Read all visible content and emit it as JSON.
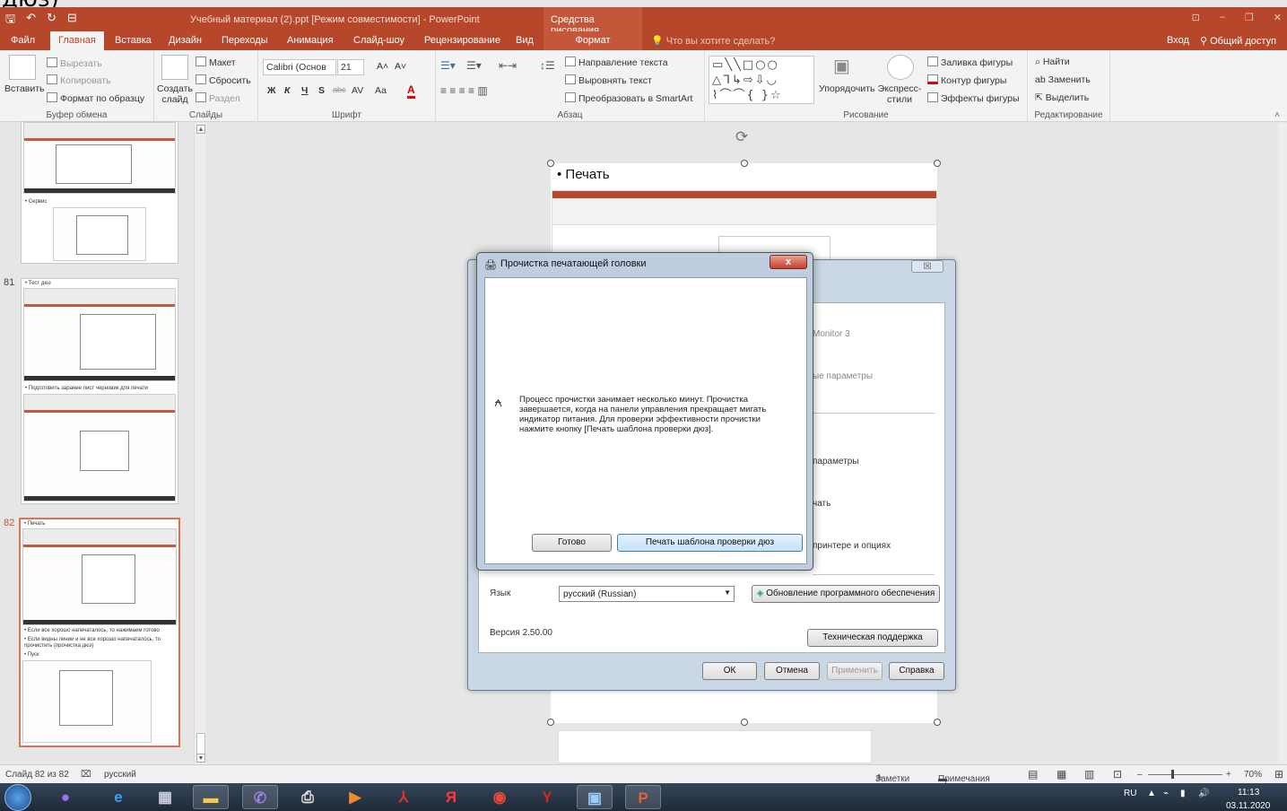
{
  "top_fragment": "дюз)",
  "titlebar": {
    "qat": [
      "🖫",
      "↶",
      "↻",
      "⊟"
    ],
    "doc_title": "Учебный материал (2).ppt [Режим совместимости] - PowerPoint",
    "context_group": "Средства рисования",
    "window_controls": [
      "⊡",
      "–",
      "❐",
      "✕"
    ]
  },
  "tabs": {
    "file": "Файл",
    "home": "Главная",
    "insert": "Вставка",
    "design": "Дизайн",
    "transitions": "Переходы",
    "animation": "Анимация",
    "slideshow": "Слайд-шоу",
    "review": "Рецензирование",
    "view": "Вид",
    "format": "Формат",
    "tell_me": "Что вы хотите сделать?",
    "signin": "Вход",
    "share": "Общий доступ"
  },
  "ribbon": {
    "clipboard": {
      "label": "Буфер обмена",
      "paste": "Вставить",
      "cut": "Вырезать",
      "copy": "Копировать",
      "format_painter": "Формат по образцу"
    },
    "slides": {
      "label": "Слайды",
      "new_slide": "Создать слайд",
      "layout": "Макет",
      "reset": "Сбросить",
      "section": "Раздел"
    },
    "font": {
      "label": "Шрифт",
      "font_name": "Calibri (Основ",
      "font_size": "21",
      "bold": "Ж",
      "italic": "К",
      "underline": "Ч",
      "shadow": "S",
      "strike": "abc",
      "spacing": "AV",
      "case": "Аа",
      "grow": "A˄",
      "shrink": "A˅"
    },
    "paragraph": {
      "label": "Абзац",
      "text_direction": "Направление текста",
      "align_text": "Выровнять текст",
      "smartart": "Преобразовать в SmartArt"
    },
    "drawing": {
      "label": "Рисование",
      "arrange": "Упорядочить",
      "quick_styles": "Экспресс-стили",
      "fill": "Заливка фигуры",
      "outline": "Контур фигуры",
      "effects": "Эффекты фигуры"
    },
    "editing": {
      "label": "Редактирование",
      "find": "Найти",
      "replace": "Заменить",
      "select": "Выделить"
    }
  },
  "thumbnails": {
    "slide80_caption": "• Сервис",
    "slide81_number": "81",
    "slide81_title": "• Тест дюз",
    "slide81_caption": "• Подготовить заранее лист черновик для печати",
    "slide82_number": "82",
    "slide82_title": "• Печать",
    "slide82_note1": "• Если все хорошо напечаталось, то нажимаем готово",
    "slide82_note2": "• Если видны линии и не все хорошо напечаталось, то прочистить (прочистка дюз)",
    "slide82_note3": "• Пуск"
  },
  "slide": {
    "bullet": "• Печать"
  },
  "back_dialog": {
    "close": "☒",
    "monitor": "Monitor 3",
    "params1": "ые параметры",
    "params2": "параметры",
    "print": "чать",
    "printer_options": "принтере и опциях",
    "lang_label": "Язык",
    "lang_value": "русский (Russian)",
    "update_btn": "Обновление программного обеспечения",
    "version": "Версия 2.50.00",
    "support_btn": "Техническая поддержка",
    "ok": "ОК",
    "cancel": "Отмена",
    "apply": "Применить",
    "help": "Справка"
  },
  "front_dialog": {
    "title": "Прочистка печатающей головки",
    "close": "x",
    "message": "Процесс прочистки занимает несколько минут. Прочистка завершается, когда на панели управления прекращает мигать индикатор питания. Для проверки эффективности прочистки нажмите кнопку [Печать шаблона проверки дюз].",
    "done": "Готово",
    "print_pattern": "Печать шаблона проверки дюз"
  },
  "statusbar": {
    "slide_of": "Слайд 82 из 82",
    "language": "русский",
    "notes": "Заметки",
    "comments": "Примечания",
    "zoom": "70%"
  },
  "taskbar": {
    "lang": "RU",
    "time": "11:13",
    "date": "03.11.2020"
  },
  "colors": {
    "accent": "#b7472a",
    "taskbar": "#1e2a38",
    "selection": "#e07050"
  }
}
